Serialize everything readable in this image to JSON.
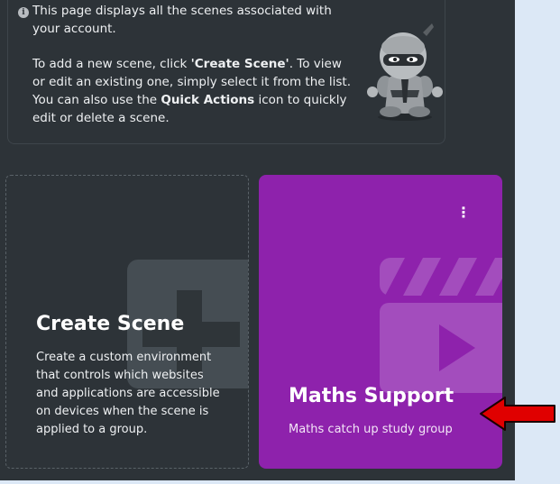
{
  "info": {
    "line1": "This page displays all the scenes associated with your account.",
    "line2_prefix": "To add a new scene, click ",
    "line2_bold1": "'Create Scene'",
    "line2_mid": ". To view or edit an existing one, simply select it from the list. You can also use the ",
    "line2_bold2": "Quick Actions",
    "line2_suffix": " icon to quickly edit or delete a scene.",
    "icon": "info-icon",
    "mascot": "ninja-mascot"
  },
  "create_card": {
    "title": "Create Scene",
    "description": "Create a custom environment that controls which websites and applications are accessible on devices when the scene is applied to a group.",
    "icon": "plus-icon"
  },
  "scenes": [
    {
      "title": "Maths Support",
      "description": "Maths catch up study group",
      "color": "#8e22ac",
      "menu_icon": "kebab-menu-icon",
      "icon": "clapperboard-icon"
    }
  ],
  "annotation": {
    "arrow_color": "#e00000"
  }
}
